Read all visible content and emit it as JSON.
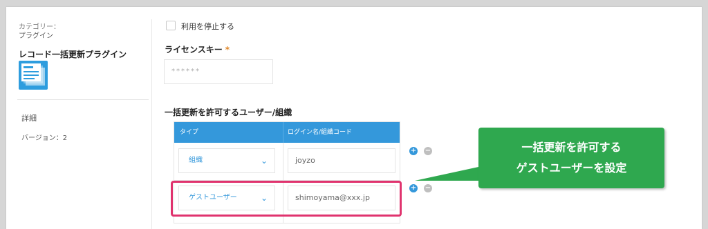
{
  "sidebar": {
    "category_label": "カテゴリー：",
    "category_value": "プラグイン",
    "plugin_name": "レコード一括更新プラグイン",
    "detail_label": "詳細",
    "version_label": "バージョン：2"
  },
  "settings": {
    "stop_label": "利用を停止する",
    "license_title": "ライセンスキー",
    "required_mark": "*",
    "license_value": "******",
    "permission_title": "一括更新を許可するユーザー/組織",
    "table": {
      "col_type": "タイプ",
      "col_code": "ログイン名/組織コード",
      "rows": [
        {
          "type": "組織",
          "code": "joyzo"
        },
        {
          "type": "ゲストユーザー",
          "code": "shimoyama@xxx.jp"
        }
      ]
    },
    "add_symbol": "+",
    "remove_symbol": "−"
  },
  "callout": {
    "line1": "一括更新を許可する",
    "line2": "ゲストユーザーを設定"
  },
  "colors": {
    "accent": "#3498db",
    "highlight": "#e0336e",
    "callout": "#2fa84f"
  }
}
